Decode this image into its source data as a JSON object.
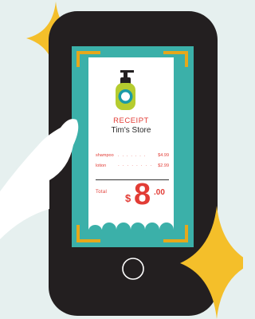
{
  "receipt": {
    "title": "RECEIPT",
    "store": "Tim's Store",
    "items": [
      {
        "name": "shampoo",
        "dots": ". . . . . . .",
        "price": "$4.99"
      },
      {
        "name": "lotion",
        "dots": "· · · · · · · · · ·",
        "price": "$2.99"
      }
    ],
    "total_label": "Total",
    "total_currency": "$",
    "total_whole": "8",
    "total_cents": ".00"
  },
  "colors": {
    "background": "#e6f0ef",
    "phone": "#231f20",
    "screen": "#3bb0a9",
    "frame": "#e6a81b",
    "receipt_red": "#e23c35",
    "sparkle": "#f4bf2a",
    "bottle": "#b5cc2f"
  }
}
